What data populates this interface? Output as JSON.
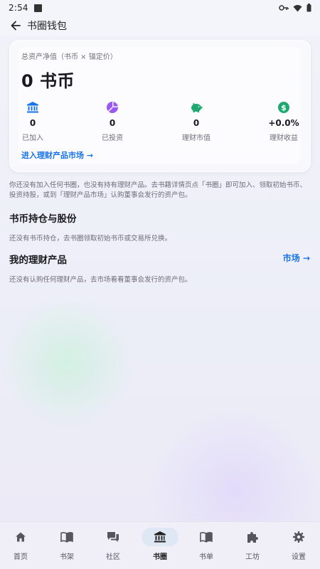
{
  "status_bar": {
    "time": "2:54",
    "icons": [
      "notification-square-icon",
      "key-icon",
      "wifi-icon",
      "battery-icon"
    ]
  },
  "app_bar": {
    "title": "书圈钱包",
    "back_icon": "arrow-left-icon"
  },
  "summary": {
    "caption": "总资产净值（书币 × 锚定价）",
    "balance": "0 书币",
    "stats": [
      {
        "icon": "bank-icon",
        "icon_color": "#1a73e8",
        "value": "0",
        "label": "已加入"
      },
      {
        "icon": "pie-chart-icon",
        "icon_color": "#9b59f0",
        "value": "0",
        "label": "已投资"
      },
      {
        "icon": "piggy-bank-icon",
        "icon_color": "#1fa971",
        "value": "0",
        "label": "理财市值"
      },
      {
        "icon": "dollar-circle-icon",
        "icon_color": "#1fa971",
        "value": "+0.0%",
        "label": "理财收益"
      }
    ],
    "market_link": "进入理财产品市场 →"
  },
  "hint": "你还没有加入任何书圈，也没有持有理财产品。去书籍详情页点「书圈」即可加入、领取初始书币、投资持股，或到「理财产品市场」认购董事会发行的资产包。",
  "holdings": {
    "title": "书币持仓与股份",
    "empty": "还没有书币持仓，去书圈领取初始书币或交易所兑换。"
  },
  "products": {
    "title": "我的理财产品",
    "market_button": "市场 →",
    "empty": "还没有认购任何理财产品，去市场看看董事会发行的资产包。"
  },
  "bottom_nav": {
    "items": [
      {
        "icon": "home-icon",
        "label": "首页",
        "active": false
      },
      {
        "icon": "book-open-icon",
        "label": "书架",
        "active": false
      },
      {
        "icon": "chat-icon",
        "label": "社区",
        "active": false
      },
      {
        "icon": "bank-icon",
        "label": "书圈",
        "active": true
      },
      {
        "icon": "book-open-icon",
        "label": "书单",
        "active": false
      },
      {
        "icon": "puzzle-icon",
        "label": "工坊",
        "active": false
      },
      {
        "icon": "gear-icon",
        "label": "设置",
        "active": false
      }
    ]
  },
  "colors": {
    "accent": "#1a73e8",
    "green": "#1fa971",
    "purple": "#9b59f0"
  }
}
